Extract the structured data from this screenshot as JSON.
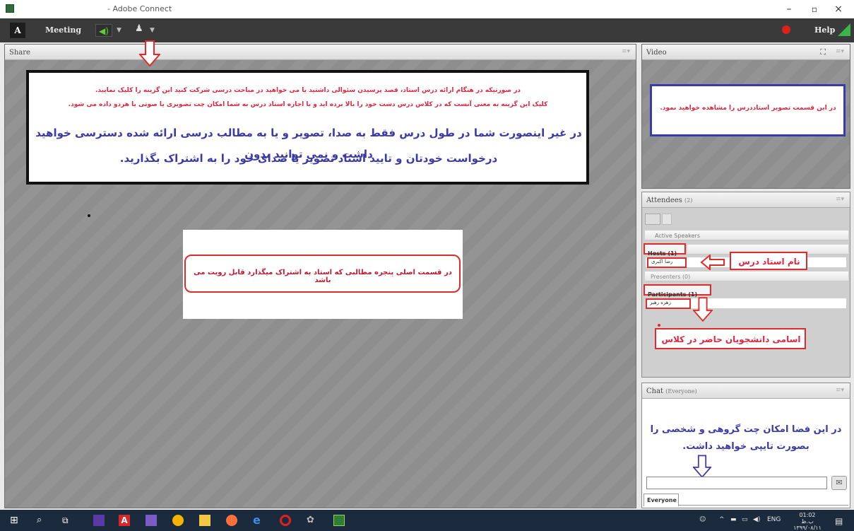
{
  "window": {
    "title": "- Adobe Connect",
    "minimize": "–",
    "maximize": "▫",
    "close": "×"
  },
  "menubar": {
    "logo": "A",
    "logo_sub": "Adobe",
    "meeting": "Meeting",
    "help": "Help"
  },
  "share_pod": {
    "title": "Share",
    "top_notice": {
      "line1": "در صورتیکه در هنگام ارائه درس استاد، قصد پرسیدن سئوالی داشتید یا می خواهید در مباحث درسی شرکت کنید این گزینه را کلیک نمایید.",
      "line2": "کلیک این گزینه به معنی آنست که در کلاس درس دست خود را بالا برده اید و با اجازه استاد درس به شما امکان چت تصویری یا صوتی یا هردو داده می شود.",
      "line3": "در غیر اینصورت شما در طول درس فقط به صدا، تصویر و یا به مطالب درسی ارائه شده دسترسی خواهید داشت و نمی توانید بدون",
      "line4": "درخواست خودتان و تایید استاد تصویر یا صدای خود را به اشتراک بگذارید."
    },
    "center_notice": "در قسمت اصلی پنجره مطالبی که استاد به اشتراک میگذارد قابل رویت می باشد"
  },
  "video_pod": {
    "title": "Video",
    "notice": "در این قسمت تصویر استاددرس را مشاهده خواهید نمود."
  },
  "attendees_pod": {
    "title": "Attendees",
    "count": "(2)",
    "active_speakers": "Active Speakers",
    "hosts": "Hosts (1)",
    "host_name": "رضا اکبری",
    "presenters": "Presenters (0)",
    "participants": "Participants (1)",
    "participant_name": "زهره رهبر",
    "label_teacher": "نام استاد درس",
    "label_students": "اسامی دانشجویان حاضر در کلاس"
  },
  "chat_pod": {
    "title": "Chat",
    "scope": "(Everyone)",
    "notice_line1": "در این فضا امکان چت گروهی و شخصی را",
    "notice_line2": "بصورت تایپی خواهید داشت.",
    "tab": "Everyone"
  },
  "taskbar": {
    "lang": "ENG",
    "time": "01:02 ب.ظ",
    "date": "۱۳۹۹/۰۸/۱۱"
  },
  "colors": {
    "accent_red": "#e22a2a",
    "text_blue": "#3a3aa8",
    "speaker_green": "#5ad13a"
  }
}
